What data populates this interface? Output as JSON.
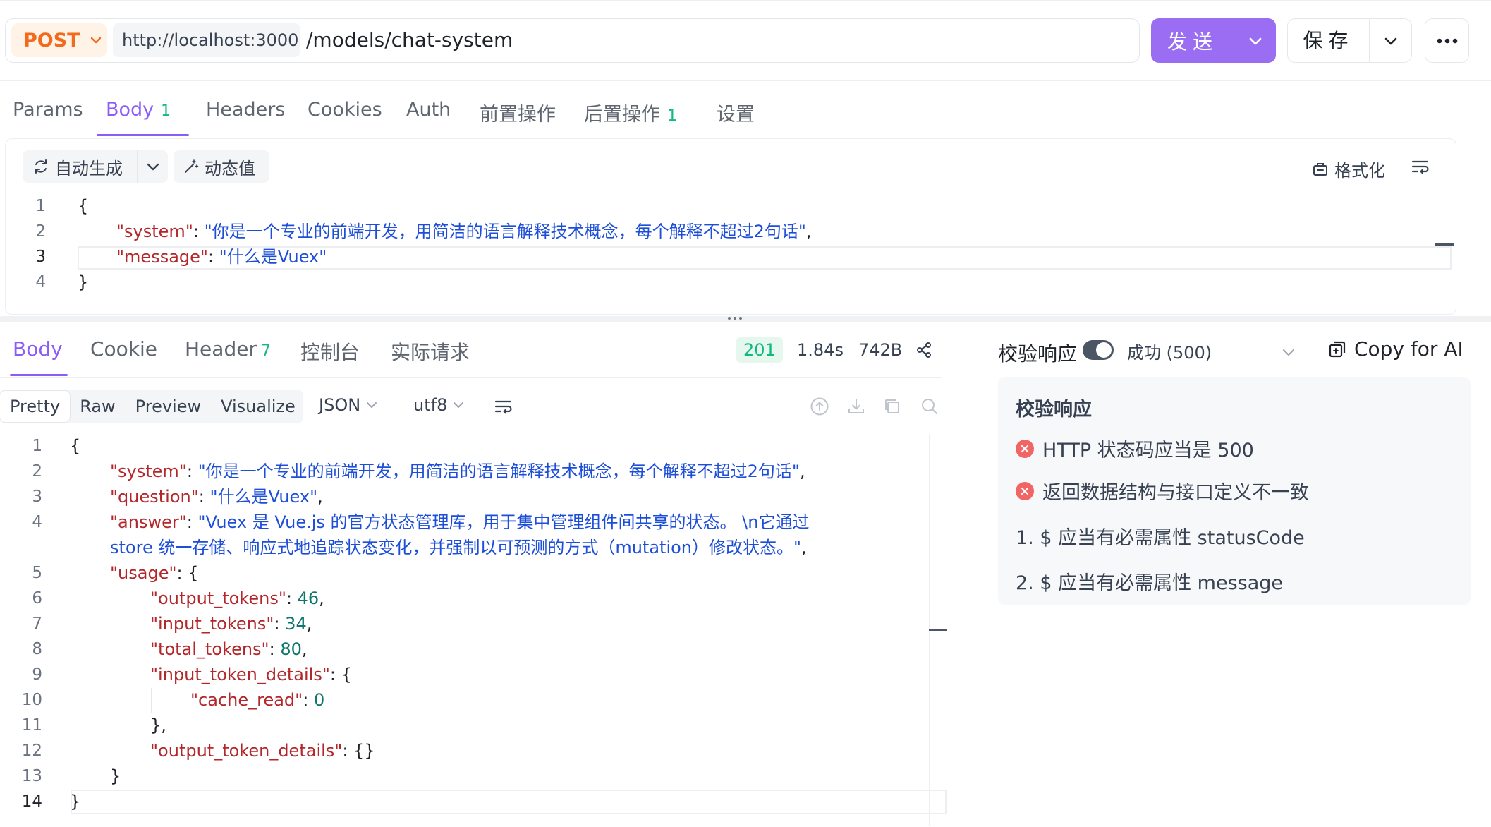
{
  "request": {
    "method": "POST",
    "base_url": "http://localhost:3000",
    "path": "/models/chat-system",
    "send_label": "发送",
    "save_label": "保存"
  },
  "request_tabs": [
    {
      "label": "Params"
    },
    {
      "label": "Body",
      "count": "1",
      "active": true
    },
    {
      "label": "Headers"
    },
    {
      "label": "Cookies"
    },
    {
      "label": "Auth"
    },
    {
      "label": "前置操作"
    },
    {
      "label": "后置操作",
      "count": "1"
    },
    {
      "label": "设置"
    }
  ],
  "body_toolbar": {
    "auto_generate": "自动生成",
    "dynamic_value": "动态值",
    "format": "格式化"
  },
  "request_body_lines": [
    {
      "n": "1",
      "text": "{"
    },
    {
      "n": "2",
      "key": "system",
      "value": "你是一个专业的前端开发，用简洁的语言解释技术概念，每个解释不超过2句话",
      "trail": ","
    },
    {
      "n": "3",
      "key": "message",
      "value": "什么是Vuex",
      "trail": ""
    },
    {
      "n": "4",
      "text": "}"
    }
  ],
  "response_tabs": [
    {
      "label": "Body",
      "active": true
    },
    {
      "label": "Cookie"
    },
    {
      "label": "Header",
      "count": "7"
    },
    {
      "label": "控制台"
    },
    {
      "label": "实际请求"
    }
  ],
  "response_meta": {
    "status": "201",
    "time": "1.84s",
    "size": "742B"
  },
  "response_format": {
    "modes": [
      "Pretty",
      "Raw",
      "Preview",
      "Visualize"
    ],
    "active": "Pretty",
    "language": "JSON",
    "encoding": "utf8"
  },
  "response_body_lines": [
    {
      "n": "1",
      "indent": 0,
      "text": "{"
    },
    {
      "n": "2",
      "indent": 1,
      "key": "system",
      "str": "你是一个专业的前端开发，用简洁的语言解释技术概念，每个解释不超过2句话",
      "trail": ","
    },
    {
      "n": "3",
      "indent": 1,
      "key": "question",
      "str": "什么是Vuex",
      "trail": ","
    },
    {
      "n": "4",
      "indent": 1,
      "key": "answer",
      "str": "Vuex 是 Vue.js 的官方状态管理库，用于集中管理组件间共享的状态。 \\n它通过",
      "trail": ""
    },
    {
      "n": "",
      "indent": 1,
      "cont": "store 统一存储、响应式地追踪状态变化，并强制以可预测的方式（mutation）修改状态。\"",
      "trail": ","
    },
    {
      "n": "5",
      "indent": 1,
      "key": "usage",
      "text_after": ": {"
    },
    {
      "n": "6",
      "indent": 2,
      "key": "output_tokens",
      "num": "46",
      "trail": ","
    },
    {
      "n": "7",
      "indent": 2,
      "key": "input_tokens",
      "num": "34",
      "trail": ","
    },
    {
      "n": "8",
      "indent": 2,
      "key": "total_tokens",
      "num": "80",
      "trail": ","
    },
    {
      "n": "9",
      "indent": 2,
      "key": "input_token_details",
      "text_after": ": {"
    },
    {
      "n": "10",
      "indent": 3,
      "key": "cache_read",
      "num": "0",
      "trail": ""
    },
    {
      "n": "11",
      "indent": 2,
      "text": "},"
    },
    {
      "n": "12",
      "indent": 2,
      "key": "output_token_details",
      "text_after": ": {}"
    },
    {
      "n": "13",
      "indent": 1,
      "text": "}"
    },
    {
      "n": "14",
      "indent": 0,
      "text": "}"
    }
  ],
  "validation": {
    "toggle_label": "校验响应",
    "result_select": "成功 (500)",
    "copy_for_ai": "Copy for AI",
    "panel_title": "校验响应",
    "errors": [
      "HTTP 状态码应当是 500",
      "返回数据结构与接口定义不一致"
    ],
    "details": [
      "1. $ 应当有必需属性 statusCode",
      "2. $ 应当有必需属性 message"
    ]
  },
  "colors": {
    "accent": "#8b5cf6",
    "send_bg": "#9b6df3",
    "method": "#f26b1d",
    "success": "#10b981",
    "error": "#f26565"
  }
}
